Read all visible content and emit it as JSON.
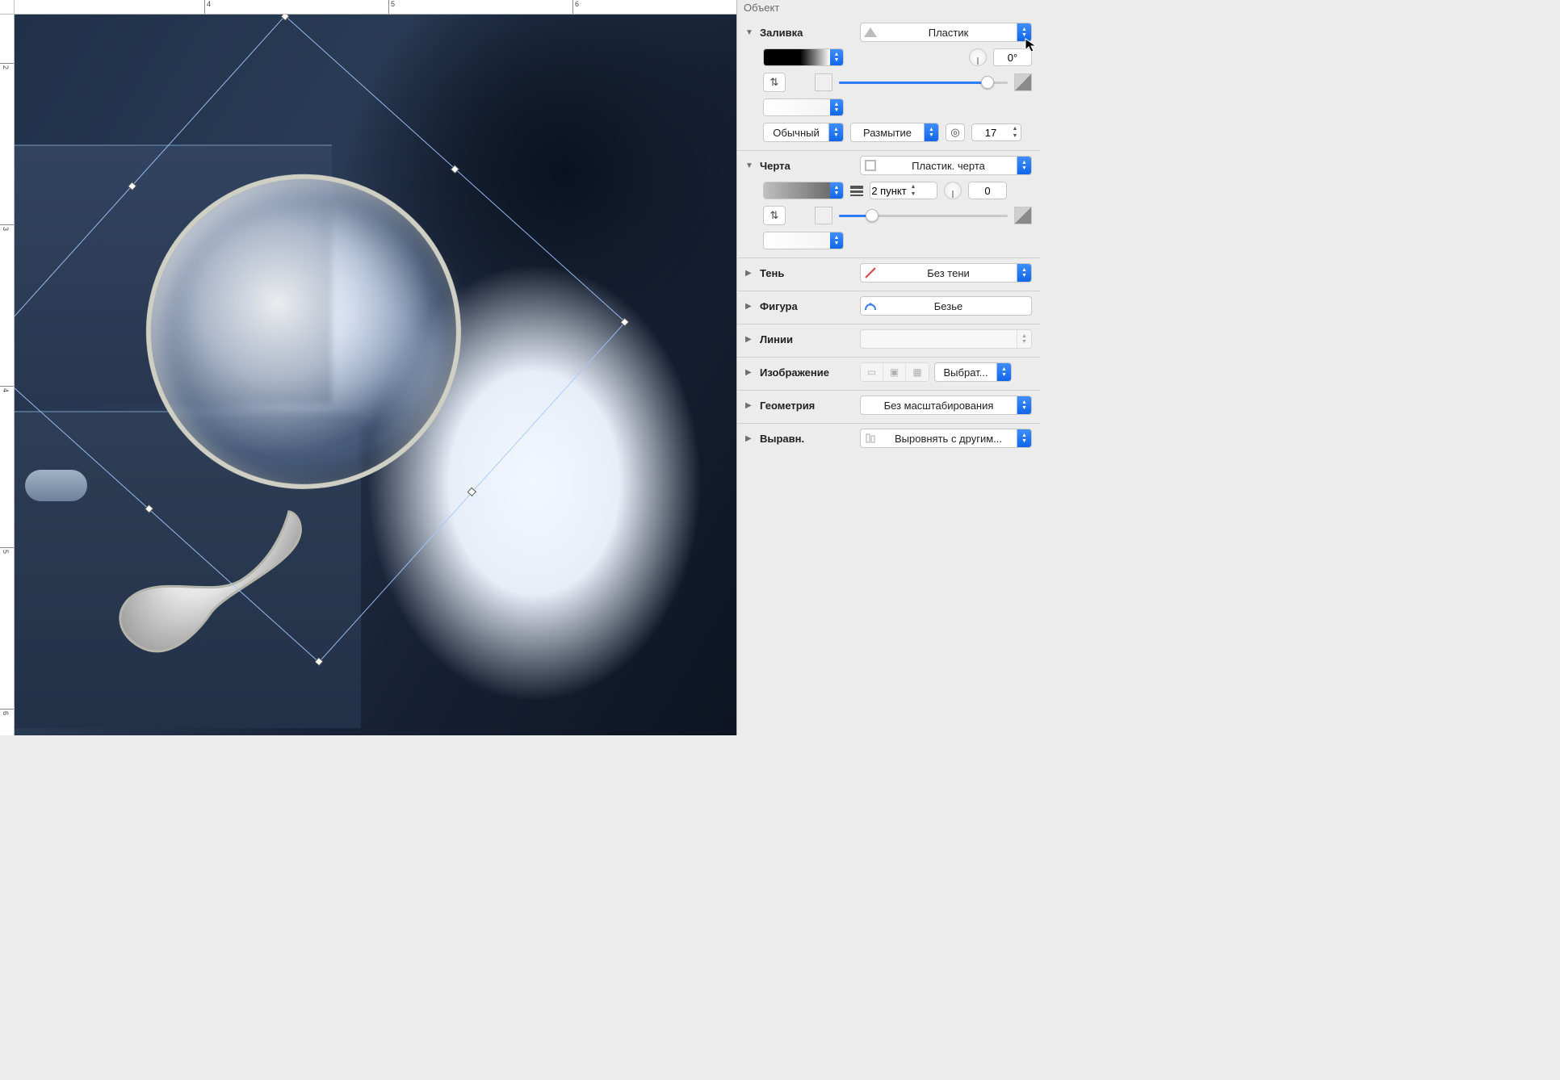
{
  "panel_title": "Объект",
  "ruler": {
    "h_labels": [
      "4",
      "5",
      "6"
    ],
    "v_labels": [
      "2",
      "3",
      "4",
      "5",
      "6"
    ]
  },
  "fill": {
    "label": "Заливка",
    "type": "Пластик",
    "angle": "0°",
    "blend_mode": "Обычный",
    "blur_label": "Размытие",
    "blur_value": "17"
  },
  "stroke": {
    "label": "Черта",
    "type": "Пластик. черта",
    "width": "2 пункт",
    "angle": "0"
  },
  "shadow": {
    "label": "Тень",
    "value": "Без тени"
  },
  "shape": {
    "label": "Фигура",
    "value": "Безье"
  },
  "lines": {
    "label": "Линии",
    "value": ""
  },
  "image": {
    "label": "Изображение",
    "choose": "Выбрат..."
  },
  "geometry": {
    "label": "Геометрия",
    "value": "Без масштабирования"
  },
  "align": {
    "label": "Выравн.",
    "value": "Выровнять с другим..."
  }
}
